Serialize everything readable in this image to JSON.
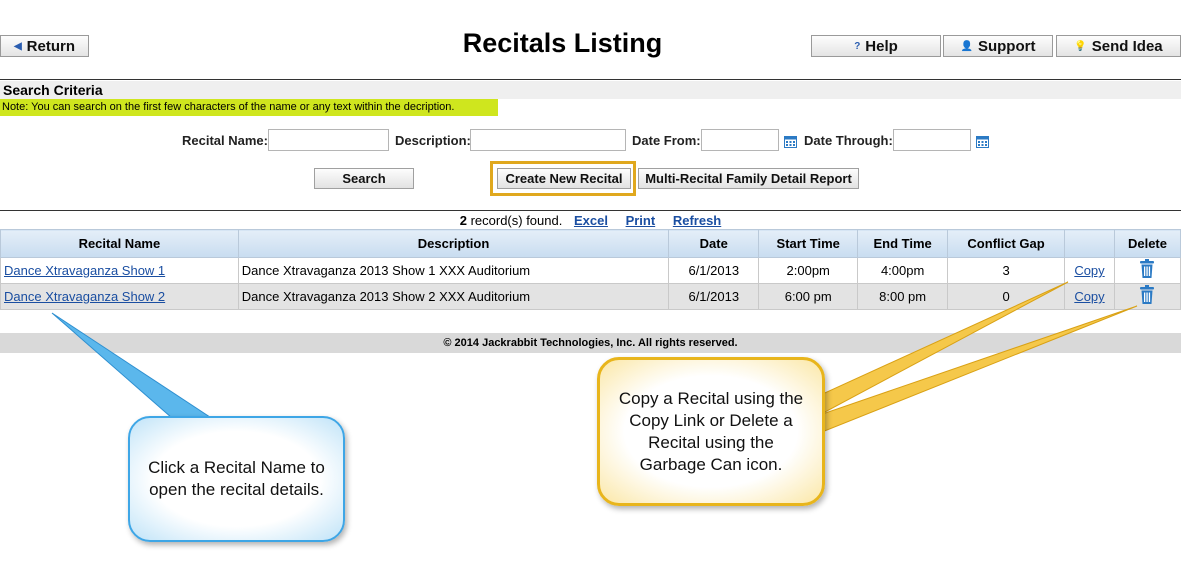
{
  "header": {
    "return_label": "Return",
    "title": "Recitals Listing",
    "help_label": "Help",
    "support_label": "Support",
    "idea_label": "Send Idea"
  },
  "search": {
    "heading": "Search Criteria",
    "note": "Note: You can search on the first few characters of the name or any text within the decription.",
    "name_label": "Recital Name:",
    "name_value": "",
    "desc_label": "Description:",
    "desc_value": "",
    "from_label": "Date From:",
    "from_value": "",
    "through_label": "Date Through:",
    "through_value": "",
    "search_button": "Search",
    "create_button": "Create New Recital",
    "report_button": "Multi-Recital Family Detail Report"
  },
  "results": {
    "count": "2",
    "found_text": " record(s) found.",
    "excel": "Excel",
    "print": "Print",
    "refresh": "Refresh"
  },
  "table": {
    "headers": [
      "Recital Name",
      "Description",
      "Date",
      "Start Time",
      "End Time",
      "Conflict Gap",
      "",
      "Delete"
    ],
    "rows": [
      {
        "name": "Dance Xtravaganza Show 1",
        "description": "Dance Xtravaganza 2013 Show 1 XXX Auditorium",
        "date": "6/1/2013",
        "start": "2:00pm",
        "end": "4:00pm",
        "gap": "3",
        "copy": "Copy"
      },
      {
        "name": "Dance Xtravaganza Show 2",
        "description": "Dance Xtravaganza 2013 Show 2 XXX Auditorium",
        "date": "6/1/2013",
        "start": "6:00 pm",
        "end": "8:00 pm",
        "gap": "0",
        "copy": "Copy"
      }
    ]
  },
  "footer": "© 2014  Jackrabbit Technologies, Inc.   All rights reserved.",
  "callouts": {
    "left": "Click a Recital Name to open the recital details.",
    "right": "Copy a Recital using the Copy Link or Delete a Recital using the Garbage Can icon."
  },
  "colors": {
    "accent": "#1a4ea1",
    "highlight": "#cfe61e",
    "callout_blue": "#3ea6e6",
    "callout_gold": "#e8b51c"
  }
}
